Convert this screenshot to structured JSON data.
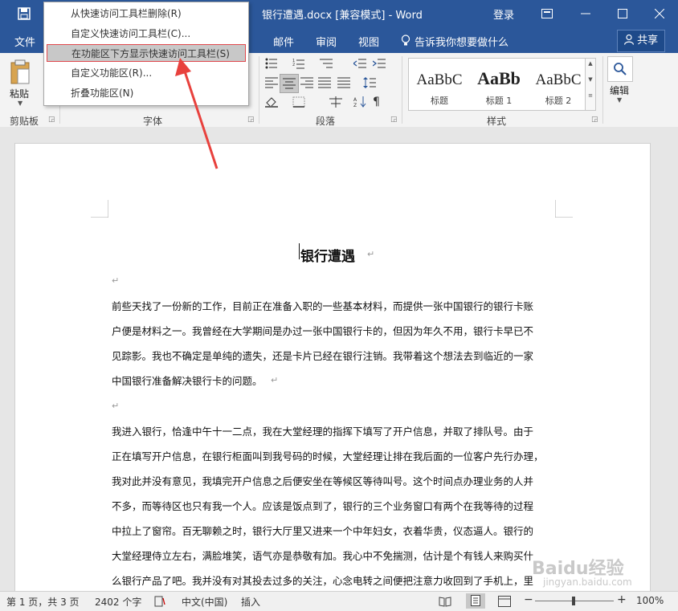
{
  "titlebar": {
    "title": "银行遭遇.docx [兼容模式] - Word",
    "login": "登录"
  },
  "tabs": [
    "文件",
    "邮件",
    "审阅",
    "视图"
  ],
  "tell_me": "告诉我你想要做什么",
  "share": "共享",
  "ribbon": {
    "paste": "粘贴",
    "groups": {
      "clipboard": "剪贴板",
      "font": "字体",
      "paragraph": "段落",
      "styles": "样式"
    },
    "styles": [
      {
        "sample": "AaBbC",
        "name": "标题"
      },
      {
        "sample": "AaBb",
        "name": "标题 1"
      },
      {
        "sample": "AaBbC",
        "name": "标题 2"
      }
    ],
    "editing": "编辑"
  },
  "context_menu": [
    "从快速访问工具栏删除(R)",
    "自定义快速访问工具栏(C)...",
    "在功能区下方显示快速访问工具栏(S)",
    "自定义功能区(R)...",
    "折叠功能区(N)"
  ],
  "document": {
    "title": "银行遭遇",
    "lines": [
      "前些天找了一份新的工作，目前正在准备入职的一些基本材料，而提供一张中国银行的银行卡账",
      "户便是材料之一。我曾经在大学期间是办过一张中国银行卡的，但因为年久不用，银行卡早已不",
      "见踪影。我也不确定是单纯的遗失，还是卡片已经在银行注销。我带着这个想法去到临近的一家",
      "中国银行准备解决银行卡的问题。",
      "我进入银行，恰逢中午十一二点，我在大堂经理的指挥下填写了开户信息，并取了排队号。由于",
      "正在填写开户信息，在银行柜面叫到我号码的时候，大堂经理让排在我后面的一位客户先行办理，",
      "我对此并没有意见，我填完开户信息之后便安坐在等候区等待叫号。这个时间点办理业务的人并",
      "不多，而等待区也只有我一个人。应该是饭点到了，银行的三个业务窗口有两个在我等待的过程",
      "中拉上了窗帘。百无聊赖之时，银行大厅里又进来一个中年妇女，衣着华贵，仪态逼人。银行的",
      "大堂经理侍立左右，满脸堆笑，语气亦是恭敬有加。我心中不免揣测，估计是个有钱人来购买什",
      "么银行产品了吧。我并没有对其投去过多的关注，心念电转之间便把注意力收回到了手机上，里"
    ]
  },
  "statusbar": {
    "page": "第 1 页，共 3 页",
    "words": "2402 个字",
    "lang": "中文(中国)",
    "mode": "插入",
    "zoom": "100%"
  },
  "watermark": {
    "brand": "Baidu经验",
    "url": "jingyan.baidu.com"
  },
  "colors": {
    "accent": "#2b579a",
    "highlight_border": "#e0474c",
    "arrow": "#e8413d"
  }
}
